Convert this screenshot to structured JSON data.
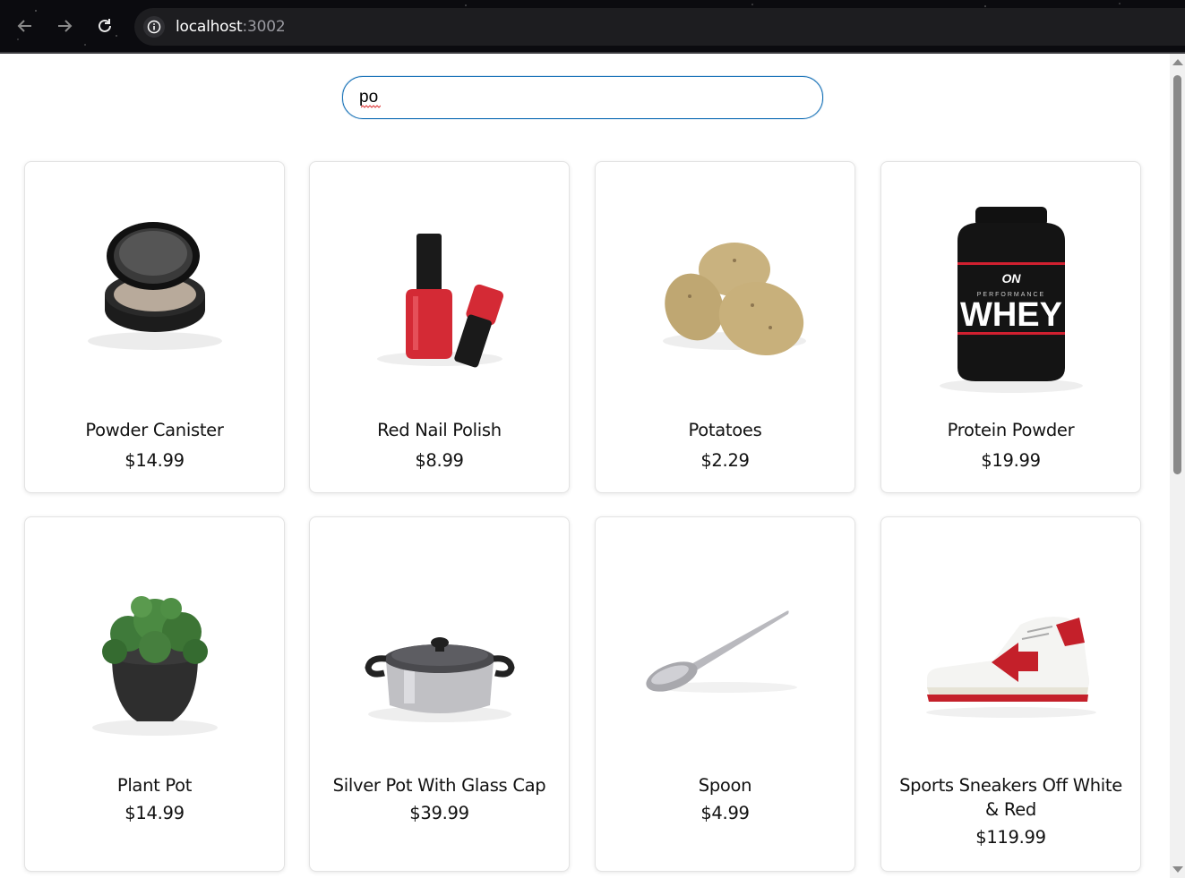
{
  "browser": {
    "url_host": "localhost",
    "url_port": ":3002"
  },
  "search": {
    "value": "po"
  },
  "products": [
    {
      "name": "Powder Canister",
      "price": "$14.99",
      "icon": "powder-compact-icon"
    },
    {
      "name": "Red Nail Polish",
      "price": "$8.99",
      "icon": "nail-polish-icon"
    },
    {
      "name": "Potatoes",
      "price": "$2.29",
      "icon": "potatoes-icon"
    },
    {
      "name": "Protein Powder",
      "price": "$19.99",
      "icon": "protein-tub-icon",
      "brand": "ON",
      "label_small": "PERFORMANCE",
      "label_big": "WHEY"
    },
    {
      "name": "Plant Pot",
      "price": "$14.99",
      "icon": "plant-pot-icon"
    },
    {
      "name": "Silver Pot With Glass Cap",
      "price": "$39.99",
      "icon": "cooking-pot-icon"
    },
    {
      "name": "Spoon",
      "price": "$4.99",
      "icon": "spoon-icon"
    },
    {
      "name": "Sports Sneakers Off White & Red",
      "price": "$119.99",
      "icon": "sneaker-icon"
    }
  ],
  "colors": {
    "search_border": "#1a73b8",
    "nail_red": "#d42a35",
    "sneaker_red": "#c4202a"
  }
}
